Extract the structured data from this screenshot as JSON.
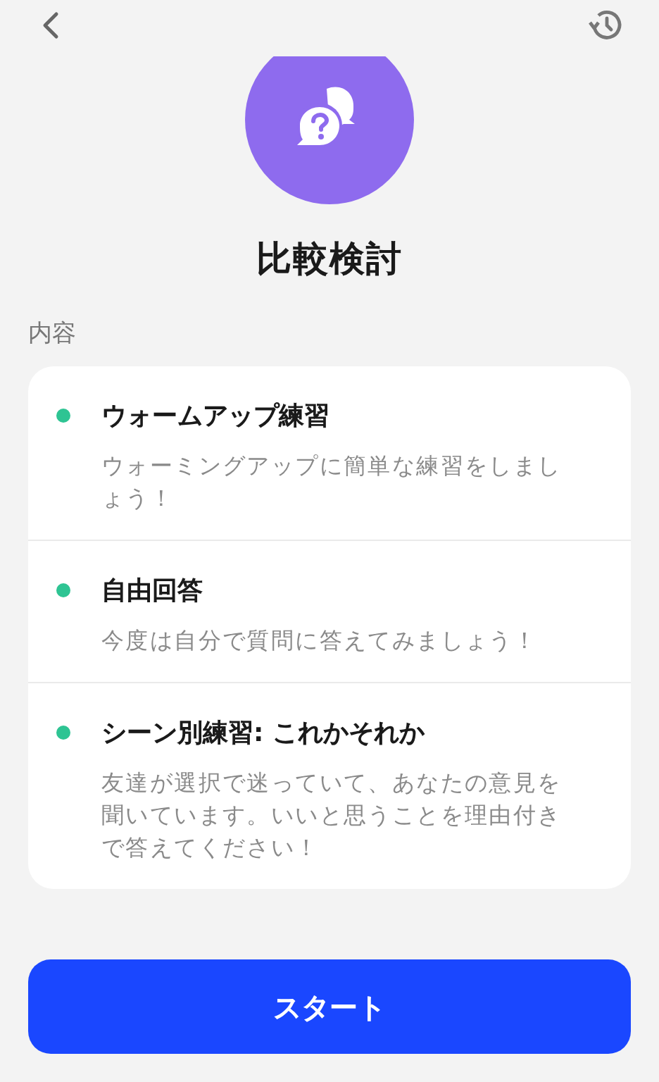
{
  "title": "比較検討",
  "section_label": "内容",
  "items": [
    {
      "title": "ウォームアップ練習",
      "description": "ウォーミングアップに簡単な練習をしましょう！"
    },
    {
      "title": "自由回答",
      "description": "今度は自分で質問に答えてみましょう！"
    },
    {
      "title": "シーン別練習: これかそれか",
      "description": "友達が選択で迷っていて、あなたの意見を聞いています。いいと思うことを理由付きで答えてください！"
    }
  ],
  "start_button": "スタート"
}
